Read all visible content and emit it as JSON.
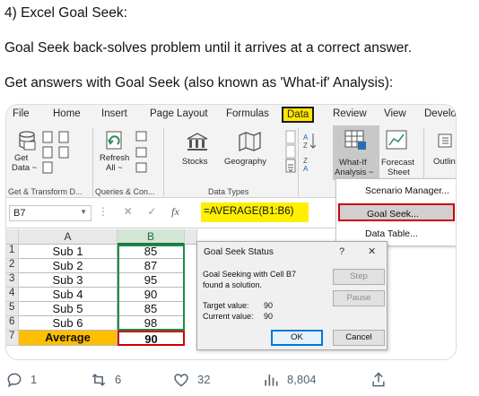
{
  "post": {
    "heading": "4) Excel Goal Seek:",
    "line1": "Goal Seek back-solves problem until it arrives at a correct answer.",
    "line2": "Get answers with Goal Seek (also known as 'What-if' Analysis):"
  },
  "ribbon": {
    "tabs": [
      "File",
      "Home",
      "Insert",
      "Page Layout",
      "Formulas",
      "Data",
      "Review",
      "View",
      "Develo"
    ],
    "active_tab": "Data",
    "get_data_line1": "Get",
    "get_data_line2": "Data ~",
    "refresh_line1": "Refresh",
    "refresh_line2": "All ~",
    "stocks": "Stocks",
    "geography": "Geography",
    "whatif_line1": "What-If",
    "whatif_line2": "Analysis ~",
    "forecast_line1": "Forecast",
    "forecast_line2": "Sheet",
    "outline": "Outlin",
    "group_get_transform": "Get & Transform D...",
    "group_queries": "Queries & Con...",
    "group_data_types": "Data Types"
  },
  "formula_bar": {
    "name_box": "B7",
    "fx": "fx",
    "formula": "=AVERAGE(B1:B6)"
  },
  "grid": {
    "col_a": "A",
    "col_b": "B",
    "rows": [
      {
        "num": "1",
        "a": "Sub 1",
        "b": "85"
      },
      {
        "num": "2",
        "a": "Sub 2",
        "b": "87"
      },
      {
        "num": "3",
        "a": "Sub 3",
        "b": "95"
      },
      {
        "num": "4",
        "a": "Sub 4",
        "b": "90"
      },
      {
        "num": "5",
        "a": "Sub 5",
        "b": "85"
      },
      {
        "num": "6",
        "a": "Sub 6",
        "b": "98"
      },
      {
        "num": "7",
        "a": "Average",
        "b": "90"
      }
    ]
  },
  "whatif_menu": {
    "items": [
      "Scenario Manager...",
      "Goal Seek...",
      "Data Table..."
    ],
    "highlighted": "Goal Seek..."
  },
  "dialog": {
    "title": "Goal Seek Status",
    "help": "?",
    "close": "✕",
    "msg_line1": "Goal Seeking with Cell B7",
    "msg_line2": "found a solution.",
    "target_label": "Target value:",
    "target_value": "90",
    "current_label": "Current value:",
    "current_value": "90",
    "step": "Step",
    "pause": "Pause",
    "ok": "OK",
    "cancel": "Cancel"
  },
  "engagement": {
    "replies": "1",
    "reposts": "6",
    "likes": "32",
    "views": "8,804"
  },
  "colors": {
    "data_tab_highlight": "#ffe600",
    "formula_highlight": "#ffef00",
    "average_row": "#ffbf00",
    "red_outline": "#d00000",
    "excel_green": "#217346",
    "meta_text": "#536471"
  },
  "icons": [
    "database-icon",
    "refresh-icon",
    "stocks-icon",
    "geography-map-icon",
    "sort-az-icon",
    "sort-za-icon",
    "whatif-icon",
    "forecast-icon",
    "outline-icon",
    "reply-icon",
    "repost-icon",
    "like-heart-icon",
    "views-chart-icon",
    "share-icon"
  ]
}
